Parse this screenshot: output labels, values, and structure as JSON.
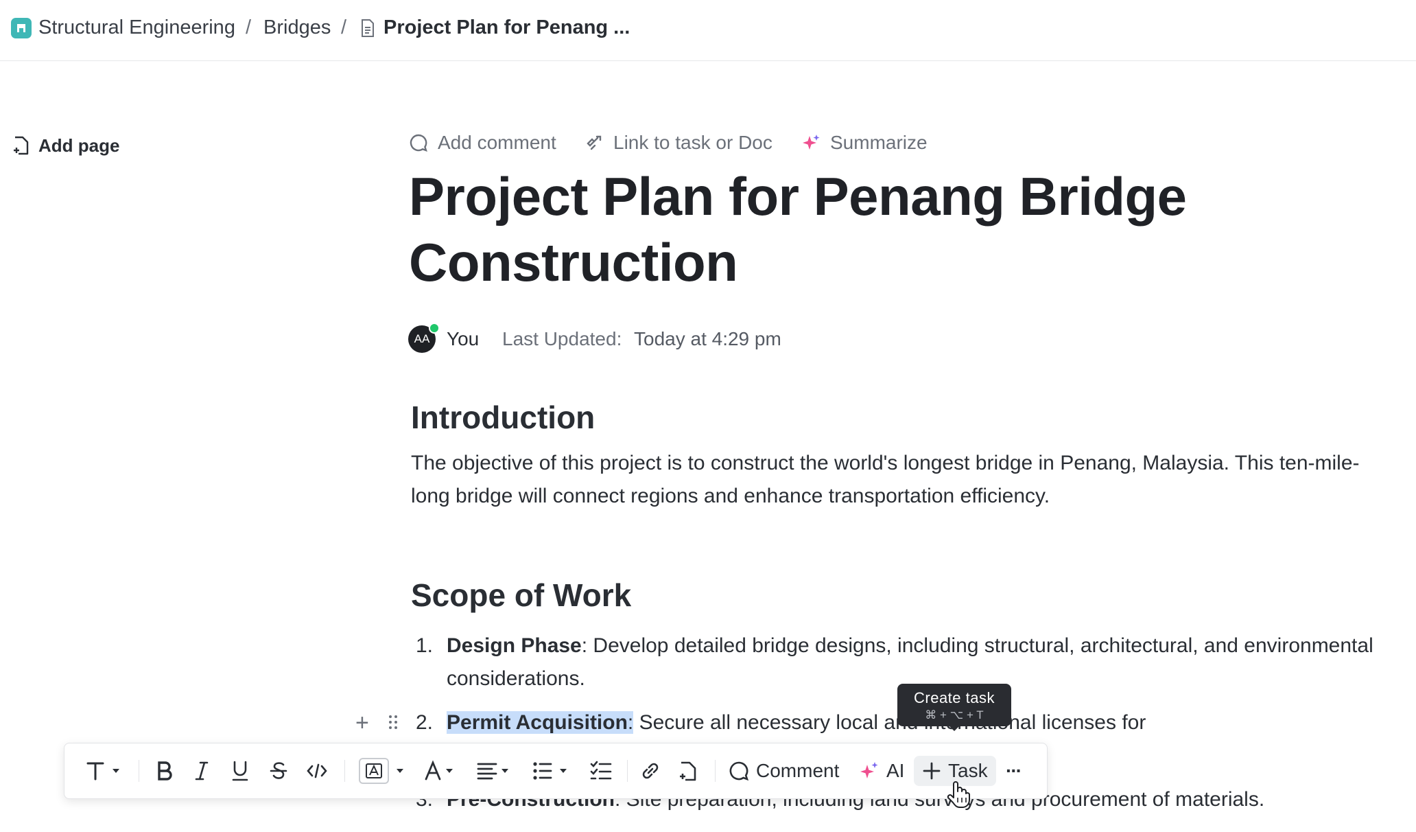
{
  "breadcrumb": {
    "space": "Structural Engineering",
    "folder": "Bridges",
    "doc": "Project Plan for Penang ...",
    "separator": "/"
  },
  "sidebar": {
    "add_page": "Add page"
  },
  "doc_actions": {
    "add_comment": "Add comment",
    "link_task": "Link to task or Doc",
    "summarize": "Summarize"
  },
  "doc": {
    "title": "Project Plan for Penang Bridge Construction",
    "author_initials": "AA",
    "author": "You",
    "last_updated_label": "Last Updated:",
    "last_updated_value": "Today at 4:29 pm"
  },
  "sections": {
    "intro": {
      "heading": "Introduction",
      "body": "The objective of this project is to construct the world's longest bridge in Penang, Malaysia. This ten-mile-long bridge will connect regions and enhance transportation efficiency."
    },
    "scope": {
      "heading": "Scope of Work",
      "items": [
        {
          "num": "1.",
          "term": "Design Phase",
          "text": ": Develop detailed bridge designs, including structural, architectural, and envi­ronmental considerations."
        },
        {
          "num": "2.",
          "term": "Permit Acquisition",
          "colon": ":",
          "text": " Secure all necessary local and international licenses for"
        },
        {
          "num": "3.",
          "term": "Pre-Construction",
          "text": ": Site preparation, including land surveys and procurement of materials."
        }
      ]
    }
  },
  "tooltip": {
    "title": "Create task",
    "keys": "⌘ + ⌥ + T"
  },
  "toolbar": {
    "comment": "Comment",
    "ai": "AI",
    "task": "Task",
    "more": "···"
  },
  "colors": {
    "accent_teal": "#3fb7b6",
    "selection": "#c7ddfa",
    "online": "#1fc76a"
  }
}
